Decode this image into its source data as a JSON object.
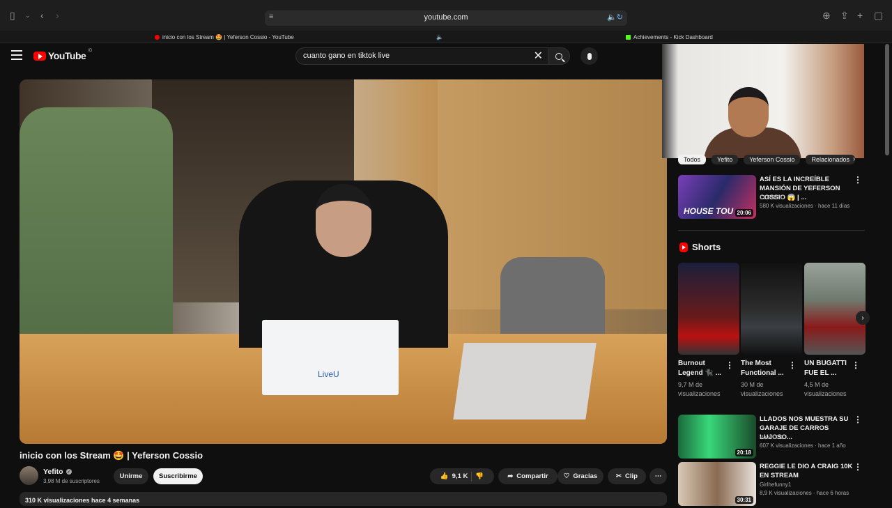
{
  "browser": {
    "url": "youtube.com",
    "tabs": [
      {
        "title": "inicio con los Stream 🤩 | Yeferson Cossio - YouTube"
      },
      {
        "title": "Achievements - Kick Dashboard"
      }
    ]
  },
  "header": {
    "logo_text": "YouTube",
    "logo_country": "ID",
    "search_value": "cuanto gano en tiktok live"
  },
  "video": {
    "title": "inicio con los Stream 🤩 | Yeferson Cossio",
    "product_label": "LiveU",
    "channel": {
      "name": "Yefito",
      "subscribers": "3,98 M de suscriptores"
    },
    "join_label": "Unirme",
    "subscribe_label": "Suscribirme",
    "likes": "9,1 K",
    "share_label": "Compartir",
    "thanks_label": "Gracias",
    "clip_label": "Clip",
    "views_line": "310 K visualizaciones  hace 4 semanas"
  },
  "chips": [
    "Todos",
    "Yefito",
    "Yeferson Cossio",
    "Relacionados"
  ],
  "related": [
    {
      "title": "ASÍ ES LA INCREÍBLE MANSIÓN DE YEFERSON COSSIO 😱 | ...",
      "channel": "CLIPS TC",
      "meta": "580 K visualizaciones · hace 11 días",
      "duration": "20:06",
      "thumb_text": "HOUSE TOU"
    },
    {
      "title": "LLADOS NOS MUESTRA SU GARAJE DE CARROS LUJOSO...",
      "channel": "WestCOL",
      "meta": "607 K visualizaciones · hace 1 año",
      "duration": "20:18"
    },
    {
      "title": "REGGIE LE DIO A CRAIG 10K EN STREAM",
      "channel": "Girlhefunny1",
      "meta": "8,9 K visualizaciones · hace 6 horas",
      "duration": "30:31"
    }
  ],
  "shorts": {
    "heading": "Shorts",
    "items": [
      {
        "title": "Burnout Legend 🐈‍⬛ ...",
        "views": "9,7 M de visualizaciones"
      },
      {
        "title": "The Most Functional ...",
        "views": "30 M de visualizaciones"
      },
      {
        "title": "UN BUGATTI FUE EL ...",
        "views": "4,5 M de visualizaciones"
      }
    ]
  },
  "colors": {
    "accent": "#ff0000",
    "background": "#0f0f0f",
    "chip": "#272727"
  }
}
